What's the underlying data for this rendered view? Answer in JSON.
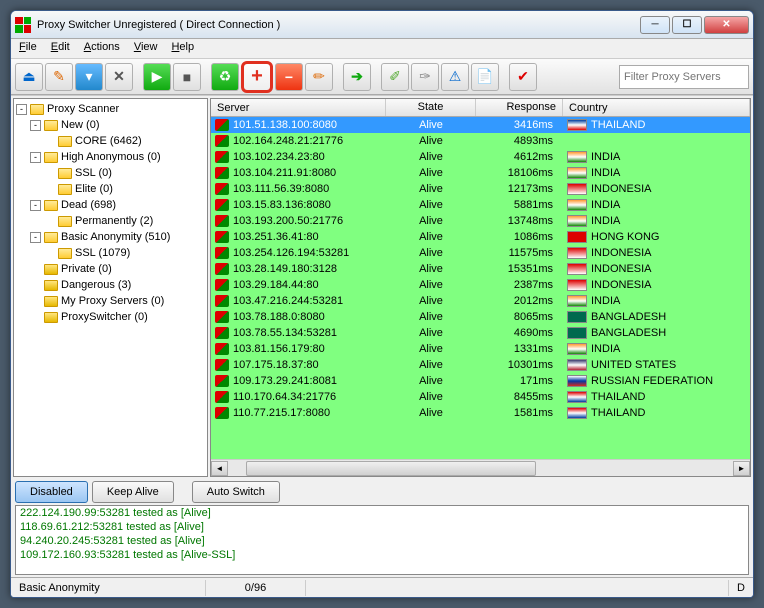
{
  "window_title": "Proxy Switcher Unregistered ( Direct Connection )",
  "menu": [
    "File",
    "Edit",
    "Actions",
    "View",
    "Help"
  ],
  "filter_placeholder": "Filter Proxy Servers",
  "tree": {
    "root": "Proxy Scanner",
    "items": [
      {
        "label": "New (0)",
        "indent": 1,
        "toggle": "-",
        "children": [
          {
            "label": "CORE (6462)",
            "indent": 2
          }
        ]
      },
      {
        "label": "High Anonymous (0)",
        "indent": 1,
        "toggle": "-",
        "children": [
          {
            "label": "SSL (0)",
            "indent": 2
          },
          {
            "label": "Elite (0)",
            "indent": 2
          }
        ]
      },
      {
        "label": "Dead (698)",
        "indent": 1,
        "toggle": "-",
        "children": [
          {
            "label": "Permanently (2)",
            "indent": 2
          }
        ]
      },
      {
        "label": "Basic Anonymity (510)",
        "indent": 1,
        "toggle": "-",
        "children": [
          {
            "label": "SSL (1079)",
            "indent": 2
          }
        ]
      },
      {
        "label": "Private (0)",
        "indent": 1
      },
      {
        "label": "Dangerous (3)",
        "indent": 1
      },
      {
        "label": "My Proxy Servers (0)",
        "indent": 1
      },
      {
        "label": "ProxySwitcher (0)",
        "indent": 1
      }
    ]
  },
  "columns": [
    "Server",
    "State",
    "Response",
    "Country"
  ],
  "rows": [
    {
      "server": "101.51.138.100:8080",
      "state": "Alive",
      "response": "3416ms",
      "country": "THAILAND",
      "flag": "#003ea0,#fff,#d00",
      "selected": true
    },
    {
      "server": "102.164.248.21:21776",
      "state": "Alive",
      "response": "4893ms",
      "country": "",
      "flag": ""
    },
    {
      "server": "103.102.234.23:80",
      "state": "Alive",
      "response": "4612ms",
      "country": "INDIA",
      "flag": "#ff9933,#fff,#138808"
    },
    {
      "server": "103.104.211.91:8080",
      "state": "Alive",
      "response": "18106ms",
      "country": "INDIA",
      "flag": "#ff9933,#fff,#138808"
    },
    {
      "server": "103.111.56.39:8080",
      "state": "Alive",
      "response": "12173ms",
      "country": "INDONESIA",
      "flag": "#d00,#fff"
    },
    {
      "server": "103.15.83.136:8080",
      "state": "Alive",
      "response": "5881ms",
      "country": "INDIA",
      "flag": "#ff9933,#fff,#138808"
    },
    {
      "server": "103.193.200.50:21776",
      "state": "Alive",
      "response": "13748ms",
      "country": "INDIA",
      "flag": "#ff9933,#fff,#138808"
    },
    {
      "server": "103.251.36.41:80",
      "state": "Alive",
      "response": "1086ms",
      "country": "HONG KONG",
      "flag": "#d00"
    },
    {
      "server": "103.254.126.194:53281",
      "state": "Alive",
      "response": "11575ms",
      "country": "INDONESIA",
      "flag": "#d00,#fff"
    },
    {
      "server": "103.28.149.180:3128",
      "state": "Alive",
      "response": "15351ms",
      "country": "INDONESIA",
      "flag": "#d00,#fff"
    },
    {
      "server": "103.29.184.44:80",
      "state": "Alive",
      "response": "2387ms",
      "country": "INDONESIA",
      "flag": "#d00,#fff"
    },
    {
      "server": "103.47.216.244:53281",
      "state": "Alive",
      "response": "2012ms",
      "country": "INDIA",
      "flag": "#ff9933,#fff,#138808"
    },
    {
      "server": "103.78.188.0:8080",
      "state": "Alive",
      "response": "8065ms",
      "country": "BANGLADESH",
      "flag": "#006a4e"
    },
    {
      "server": "103.78.55.134:53281",
      "state": "Alive",
      "response": "4690ms",
      "country": "BANGLADESH",
      "flag": "#006a4e"
    },
    {
      "server": "103.81.156.179:80",
      "state": "Alive",
      "response": "1331ms",
      "country": "INDIA",
      "flag": "#ff9933,#fff,#138808"
    },
    {
      "server": "107.175.18.37:80",
      "state": "Alive",
      "response": "10301ms",
      "country": "UNITED STATES",
      "flag": "#3c3b6e,#fff,#b22234"
    },
    {
      "server": "109.173.29.241:8081",
      "state": "Alive",
      "response": "171ms",
      "country": "RUSSIAN FEDERATION",
      "flag": "#fff,#0039a6,#d52b1e"
    },
    {
      "server": "110.170.64.34:21776",
      "state": "Alive",
      "response": "8455ms",
      "country": "THAILAND",
      "flag": "#d00,#fff,#003ea0"
    },
    {
      "server": "110.77.215.17:8080",
      "state": "Alive",
      "response": "1581ms",
      "country": "THAILAND",
      "flag": "#d00,#fff,#003ea0"
    }
  ],
  "buttons": {
    "disabled": "Disabled",
    "keepalive": "Keep Alive",
    "autoswitch": "Auto Switch"
  },
  "log_lines": [
    "222.124.190.99:53281 tested as [Alive]",
    "118.69.61.212:53281 tested as [Alive]",
    "94.240.20.245:53281 tested as [Alive]",
    "109.172.160.93:53281 tested as [Alive-SSL]"
  ],
  "status": {
    "left": "Basic Anonymity",
    "center": "0/96",
    "right": "D"
  }
}
